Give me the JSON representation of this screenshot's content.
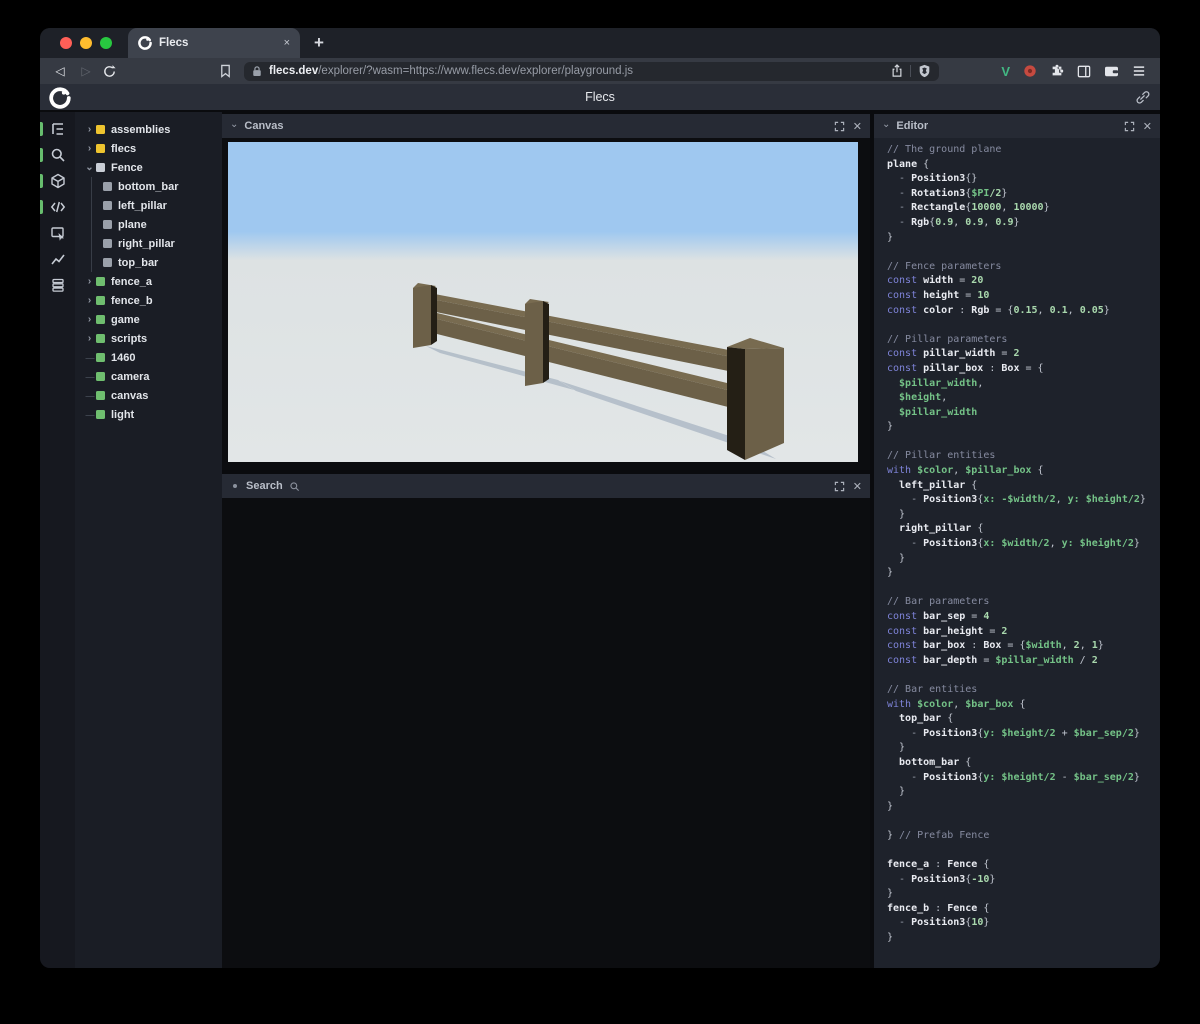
{
  "browser": {
    "tab_title": "Flecs",
    "url_host": "flecs.dev",
    "url_path": "/explorer/?wasm=https://www.flecs.dev/explorer/playground.js",
    "new_tab_label": "+",
    "close_tab_label": "×"
  },
  "header": {
    "title": "Flecs"
  },
  "sidebar": {
    "icons": [
      {
        "name": "tree-outline-icon",
        "active": true
      },
      {
        "name": "search-icon",
        "active": true
      },
      {
        "name": "cube-icon",
        "active": true
      },
      {
        "name": "code-icon",
        "active": true
      },
      {
        "name": "inspector-icon",
        "active": false
      },
      {
        "name": "chart-icon",
        "active": false
      },
      {
        "name": "layers-icon",
        "active": false
      }
    ]
  },
  "tree": {
    "items": [
      {
        "label": "assemblies",
        "square": "yellow",
        "marker": "collapsed",
        "child": false
      },
      {
        "label": "flecs",
        "square": "yellow",
        "marker": "collapsed",
        "child": false
      },
      {
        "label": "Fence",
        "square": "white",
        "marker": "expanded",
        "child": false
      },
      {
        "label": "bottom_bar",
        "square": "gray",
        "marker": "none",
        "child": true
      },
      {
        "label": "left_pillar",
        "square": "gray",
        "marker": "none",
        "child": true
      },
      {
        "label": "plane",
        "square": "gray",
        "marker": "none",
        "child": true
      },
      {
        "label": "right_pillar",
        "square": "gray",
        "marker": "none",
        "child": true
      },
      {
        "label": "top_bar",
        "square": "gray",
        "marker": "none",
        "child": true
      },
      {
        "label": "fence_a",
        "square": "green",
        "marker": "collapsed",
        "child": false
      },
      {
        "label": "fence_b",
        "square": "green",
        "marker": "collapsed",
        "child": false
      },
      {
        "label": "game",
        "square": "green",
        "marker": "collapsed",
        "child": false
      },
      {
        "label": "scripts",
        "square": "green",
        "marker": "collapsed",
        "child": false
      },
      {
        "label": "1460",
        "square": "green",
        "marker": "leaf",
        "child": false
      },
      {
        "label": "camera",
        "square": "green",
        "marker": "leaf",
        "child": false
      },
      {
        "label": "canvas",
        "square": "green",
        "marker": "leaf",
        "child": false
      },
      {
        "label": "light",
        "square": "green",
        "marker": "leaf",
        "child": false
      }
    ]
  },
  "panels": {
    "canvas_title": "Canvas",
    "search_title": "Search",
    "editor_title": "Editor"
  },
  "colors": {
    "accent-green": "#67bd6e",
    "sq-yellow": "#eec42f",
    "sq-green": "#6fbe6f",
    "sq-white": "#c9ced6",
    "sq-gray": "#9aa0aa",
    "traffic-red": "#ff5f57",
    "traffic-yellow": "#febc2e",
    "traffic-green": "#28c840",
    "vue-green": "#42b883",
    "ext-red": "#c64a40",
    "sky-top": "#9fc8f0",
    "horizon": "#dde2e3",
    "ground": "#e2e6e7",
    "fence-lit": "#6c6048",
    "fence-top": "#786b50",
    "fence-dark": "#241f15",
    "shadow": "#8b9cb0",
    "code-comment": "#868ba0",
    "code-keyword": "#7e83d8",
    "code-ident": "#e9ebf1",
    "code-var": "#74c287",
    "code-num": "#a9d8ad",
    "code-punct": "#c0c5cf"
  },
  "editor_code": {
    "lines": [
      [
        [
          "c",
          "// The ground plane"
        ]
      ],
      [
        [
          "i",
          "plane"
        ],
        [
          "p",
          " {"
        ]
      ],
      [
        [
          "d",
          "  - "
        ],
        [
          "i",
          "Position3"
        ],
        [
          "p",
          "{}"
        ]
      ],
      [
        [
          "d",
          "  - "
        ],
        [
          "i",
          "Rotation3"
        ],
        [
          "p",
          "{"
        ],
        [
          "v",
          "$PI"
        ],
        [
          "n",
          "/2"
        ],
        [
          "p",
          "}"
        ]
      ],
      [
        [
          "d",
          "  - "
        ],
        [
          "i",
          "Rectangle"
        ],
        [
          "p",
          "{"
        ],
        [
          "n",
          "10000"
        ],
        [
          "p",
          ", "
        ],
        [
          "n",
          "10000"
        ],
        [
          "p",
          "}"
        ]
      ],
      [
        [
          "d",
          "  - "
        ],
        [
          "i",
          "Rgb"
        ],
        [
          "p",
          "{"
        ],
        [
          "n",
          "0.9"
        ],
        [
          "p",
          ", "
        ],
        [
          "n",
          "0.9"
        ],
        [
          "p",
          ", "
        ],
        [
          "n",
          "0.9"
        ],
        [
          "p",
          "}"
        ]
      ],
      [
        [
          "p",
          "}"
        ]
      ],
      [],
      [
        [
          "c",
          "// Fence parameters"
        ]
      ],
      [
        [
          "k",
          "const "
        ],
        [
          "i",
          "width"
        ],
        [
          "p",
          " = "
        ],
        [
          "n",
          "20"
        ]
      ],
      [
        [
          "k",
          "const "
        ],
        [
          "i",
          "height"
        ],
        [
          "p",
          " = "
        ],
        [
          "n",
          "10"
        ]
      ],
      [
        [
          "k",
          "const "
        ],
        [
          "i",
          "color"
        ],
        [
          "p",
          " : "
        ],
        [
          "i",
          "Rgb"
        ],
        [
          "p",
          " = {"
        ],
        [
          "n",
          "0.15"
        ],
        [
          "p",
          ", "
        ],
        [
          "n",
          "0.1"
        ],
        [
          "p",
          ", "
        ],
        [
          "n",
          "0.05"
        ],
        [
          "p",
          "}"
        ]
      ],
      [],
      [
        [
          "c",
          "// Pillar parameters"
        ]
      ],
      [
        [
          "k",
          "const "
        ],
        [
          "i",
          "pillar_width"
        ],
        [
          "p",
          " = "
        ],
        [
          "n",
          "2"
        ]
      ],
      [
        [
          "k",
          "const "
        ],
        [
          "i",
          "pillar_box"
        ],
        [
          "p",
          " : "
        ],
        [
          "i",
          "Box"
        ],
        [
          "p",
          " = {"
        ]
      ],
      [
        [
          "v",
          "  $pillar_width"
        ],
        [
          "p",
          ","
        ]
      ],
      [
        [
          "v",
          "  $height"
        ],
        [
          "p",
          ","
        ]
      ],
      [
        [
          "v",
          "  $pillar_width"
        ]
      ],
      [
        [
          "p",
          "}"
        ]
      ],
      [],
      [
        [
          "c",
          "// Pillar entities"
        ]
      ],
      [
        [
          "k",
          "with "
        ],
        [
          "v",
          "$color"
        ],
        [
          "p",
          ", "
        ],
        [
          "v",
          "$pillar_box"
        ],
        [
          "p",
          " {"
        ]
      ],
      [
        [
          "i",
          "  left_pillar"
        ],
        [
          "p",
          " {"
        ]
      ],
      [
        [
          "d",
          "    - "
        ],
        [
          "i",
          "Position3"
        ],
        [
          "p",
          "{"
        ],
        [
          "v",
          "x: -$width/2"
        ],
        [
          "p",
          ", "
        ],
        [
          "v",
          "y: $height/2"
        ],
        [
          "p",
          "}"
        ]
      ],
      [
        [
          "p",
          "  }"
        ]
      ],
      [
        [
          "i",
          "  right_pillar"
        ],
        [
          "p",
          " {"
        ]
      ],
      [
        [
          "d",
          "    - "
        ],
        [
          "i",
          "Position3"
        ],
        [
          "p",
          "{"
        ],
        [
          "v",
          "x: $width/2"
        ],
        [
          "p",
          ", "
        ],
        [
          "v",
          "y: $height/2"
        ],
        [
          "p",
          "}"
        ]
      ],
      [
        [
          "p",
          "  }"
        ]
      ],
      [
        [
          "p",
          "}"
        ]
      ],
      [],
      [
        [
          "c",
          "// Bar parameters"
        ]
      ],
      [
        [
          "k",
          "const "
        ],
        [
          "i",
          "bar_sep"
        ],
        [
          "p",
          " = "
        ],
        [
          "n",
          "4"
        ]
      ],
      [
        [
          "k",
          "const "
        ],
        [
          "i",
          "bar_height"
        ],
        [
          "p",
          " = "
        ],
        [
          "n",
          "2"
        ]
      ],
      [
        [
          "k",
          "const "
        ],
        [
          "i",
          "bar_box"
        ],
        [
          "p",
          " : "
        ],
        [
          "i",
          "Box"
        ],
        [
          "p",
          " = {"
        ],
        [
          "v",
          "$width"
        ],
        [
          "p",
          ", "
        ],
        [
          "n",
          "2"
        ],
        [
          "p",
          ", "
        ],
        [
          "n",
          "1"
        ],
        [
          "p",
          "}"
        ]
      ],
      [
        [
          "k",
          "const "
        ],
        [
          "i",
          "bar_depth"
        ],
        [
          "p",
          " = "
        ],
        [
          "v",
          "$pillar_width"
        ],
        [
          "p",
          " / "
        ],
        [
          "n",
          "2"
        ]
      ],
      [],
      [
        [
          "c",
          "// Bar entities"
        ]
      ],
      [
        [
          "k",
          "with "
        ],
        [
          "v",
          "$color"
        ],
        [
          "p",
          ", "
        ],
        [
          "v",
          "$bar_box"
        ],
        [
          "p",
          " {"
        ]
      ],
      [
        [
          "i",
          "  top_bar"
        ],
        [
          "p",
          " {"
        ]
      ],
      [
        [
          "d",
          "    - "
        ],
        [
          "i",
          "Position3"
        ],
        [
          "p",
          "{"
        ],
        [
          "v",
          "y: $height/2"
        ],
        [
          "p",
          " + "
        ],
        [
          "v",
          "$bar_sep/2"
        ],
        [
          "p",
          "}"
        ]
      ],
      [
        [
          "p",
          "  }"
        ]
      ],
      [
        [
          "i",
          "  bottom_bar"
        ],
        [
          "p",
          " {"
        ]
      ],
      [
        [
          "d",
          "    - "
        ],
        [
          "i",
          "Position3"
        ],
        [
          "p",
          "{"
        ],
        [
          "v",
          "y: $height/2"
        ],
        [
          "p",
          " - "
        ],
        [
          "v",
          "$bar_sep/2"
        ],
        [
          "p",
          "}"
        ]
      ],
      [
        [
          "p",
          "  }"
        ]
      ],
      [
        [
          "p",
          "}"
        ]
      ],
      [],
      [
        [
          "p",
          "} "
        ],
        [
          "c",
          "// Prefab Fence"
        ]
      ],
      [],
      [
        [
          "i",
          "fence_a"
        ],
        [
          "p",
          " : "
        ],
        [
          "i",
          "Fence"
        ],
        [
          "p",
          " {"
        ]
      ],
      [
        [
          "d",
          "  - "
        ],
        [
          "i",
          "Position3"
        ],
        [
          "p",
          "{"
        ],
        [
          "n",
          "-10"
        ],
        [
          "p",
          "}"
        ]
      ],
      [
        [
          "p",
          "}"
        ]
      ],
      [
        [
          "i",
          "fence_b"
        ],
        [
          "p",
          " : "
        ],
        [
          "i",
          "Fence"
        ],
        [
          "p",
          " {"
        ]
      ],
      [
        [
          "d",
          "  - "
        ],
        [
          "i",
          "Position3"
        ],
        [
          "p",
          "{"
        ],
        [
          "n",
          "10"
        ],
        [
          "p",
          "}"
        ]
      ],
      [
        [
          "p",
          "}"
        ]
      ]
    ]
  }
}
